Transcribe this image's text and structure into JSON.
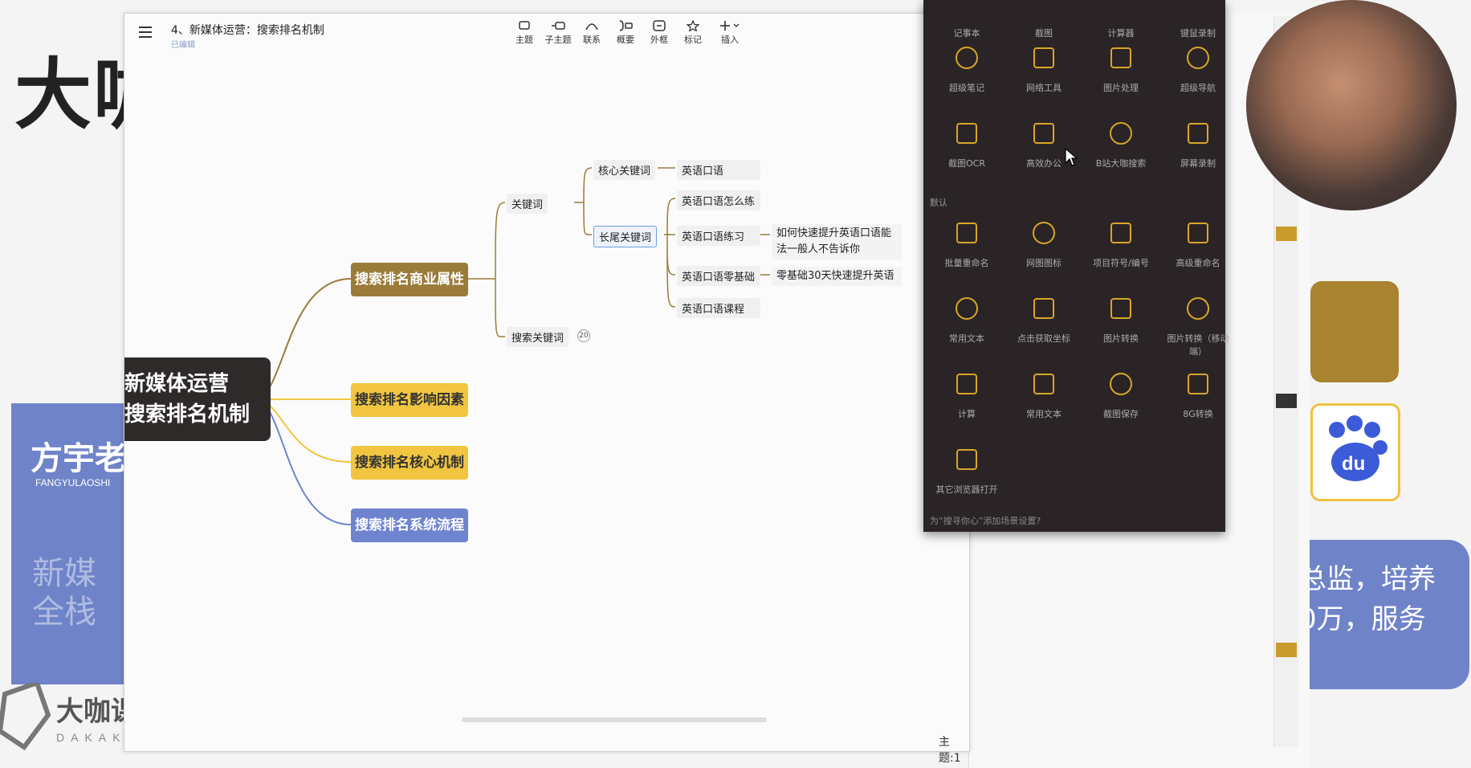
{
  "background": {
    "logo_top": "大咖",
    "left_card": {
      "name": "方宇老",
      "sub": "FANGYULAOSHI",
      "ghost": "新媒全栈"
    },
    "brand": {
      "name": "大咖课堂",
      "en": "DAKAKETANG"
    },
    "right_text": [
      "总监，培养",
      "0万，服务"
    ]
  },
  "window": {
    "title": "4、新媒体运营：搜索排名机制",
    "subtitle": "已编辑",
    "status": "主题:1",
    "toolbar": [
      {
        "label": "主题",
        "icon": "topic-icon"
      },
      {
        "label": "子主题",
        "icon": "subtopic-icon"
      },
      {
        "label": "联系",
        "icon": "relation-icon"
      },
      {
        "label": "概要",
        "icon": "summary-icon"
      },
      {
        "label": "外框",
        "icon": "boundary-icon"
      },
      {
        "label": "标记",
        "icon": "star-icon"
      },
      {
        "label": "插入",
        "icon": "plus-icon"
      }
    ]
  },
  "mindmap": {
    "root": [
      "新媒体运营",
      "搜索排名机制"
    ],
    "main": [
      {
        "label": "搜索排名商业属性",
        "color": "#9a7b3a"
      },
      {
        "label": "搜索排名影响因素",
        "color": "#f1c540"
      },
      {
        "label": "搜索排名核心机制",
        "color": "#f1c540"
      },
      {
        "label": "搜索排名系统流程",
        "color": "#6f84cf"
      }
    ],
    "keyword": "关键词",
    "search_keyword": "搜索关键词",
    "search_keyword_count": "20",
    "core_keyword": "核心关键词",
    "long_tail": "长尾关键词",
    "core_children": [
      "英语口语"
    ],
    "long_children": [
      "英语口语怎么练",
      "英语口语练习",
      "英语口语零基础",
      "英语口语课程"
    ],
    "notes": {
      "practice": [
        "如何快速提升英语口语能",
        "法一般人不告诉你"
      ],
      "zero": "零基础30天快速提升英语"
    }
  },
  "popup": {
    "rows": [
      [
        "记事本",
        "截图",
        "计算器",
        "键鼠录制"
      ],
      [
        "超级笔记",
        "网络工具",
        "图片处理",
        "超级导航"
      ],
      [
        "截图OCR",
        "高效办公",
        "B站大咖搜索",
        "屏幕录制"
      ],
      [
        "批量重命名",
        "网图图标",
        "项目符号/编号",
        "高级重命名"
      ],
      [
        "常用文本",
        "点击获取坐标",
        "图片转换",
        "图片转换（移动端）"
      ],
      [
        "计算",
        "常用文本",
        "截图保存",
        "8G转换"
      ],
      [
        "其它浏览器打开"
      ]
    ],
    "section_label": "默认",
    "footer": "为“搜寻你心”添加场景设置?"
  }
}
